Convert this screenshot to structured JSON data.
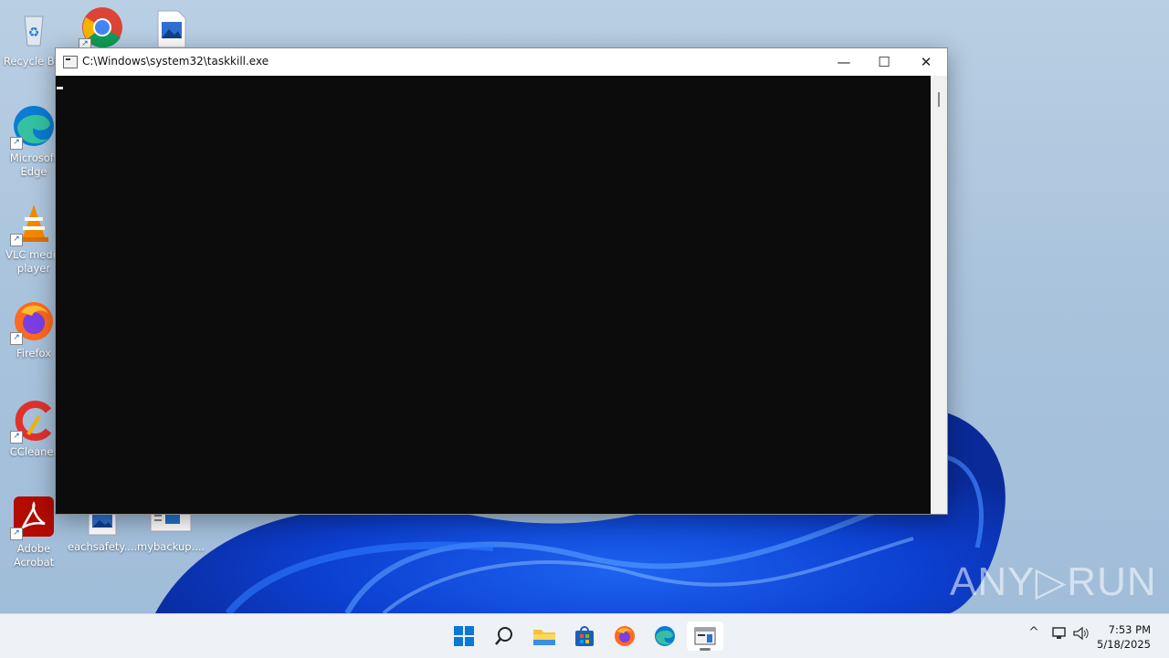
{
  "desktop": {
    "icons": [
      {
        "name": "Recycle Bin",
        "label": "Recycle Bin"
      },
      {
        "name": "Google Chrome",
        "label": ""
      },
      {
        "name": "Image file",
        "label": ""
      },
      {
        "name": "Microsoft Edge",
        "label": "Microsoft Edge"
      },
      {
        "name": "VLC media player",
        "label": "VLC media player"
      },
      {
        "name": "Firefox",
        "label": "Firefox"
      },
      {
        "name": "CCleaner",
        "label": "CCleaner"
      },
      {
        "name": "Adobe Acrobat",
        "label": "Adobe Acrobat"
      },
      {
        "name": "eachsafety",
        "label": "eachsafety...."
      },
      {
        "name": "mybackup",
        "label": "mybackup...."
      }
    ]
  },
  "window": {
    "title": "C:\\Windows\\system32\\taskkill.exe",
    "minimize": "—",
    "maximize": "☐",
    "close": "✕",
    "console_text": ""
  },
  "watermark": "ANY▷RUN",
  "taskbar": {
    "apps": [
      "Start",
      "Search",
      "File Explorer",
      "Microsoft Store",
      "Firefox",
      "Microsoft Edge",
      "Console"
    ],
    "active_app": "Console",
    "tray": {
      "chevron": "^",
      "time": "7:53 PM",
      "date": "5/18/2025"
    }
  },
  "colors": {
    "console_bg": "#0c0c0c",
    "taskbar_bg": "#eef1f5",
    "accent_blue": "#0a5ad4"
  }
}
